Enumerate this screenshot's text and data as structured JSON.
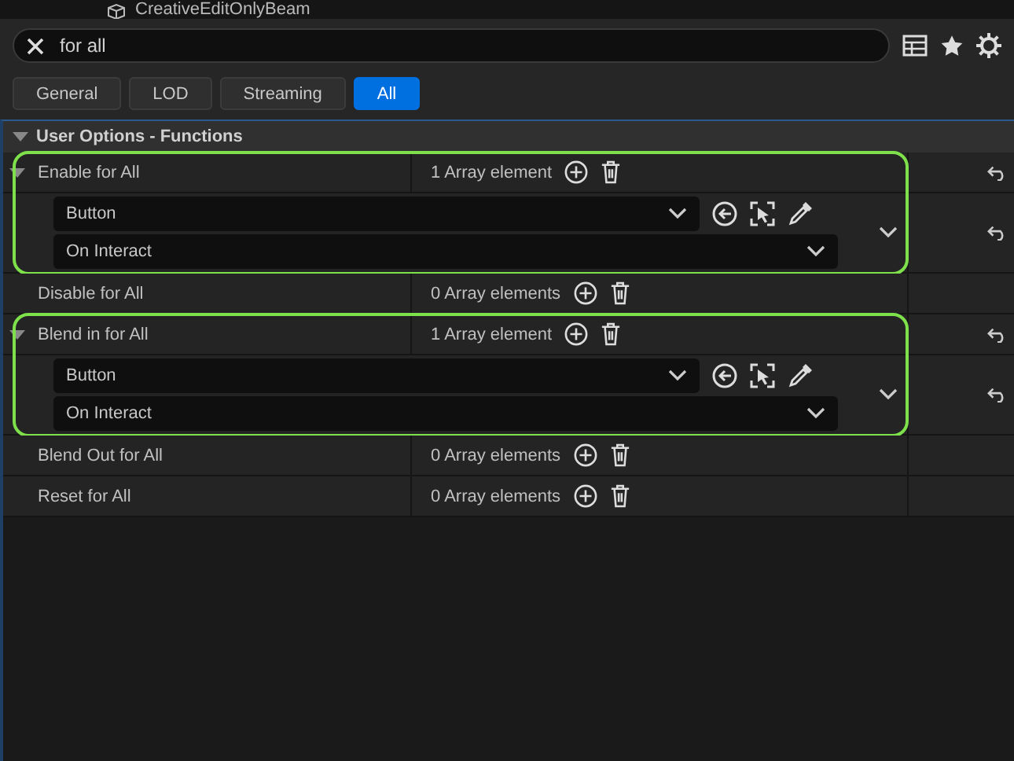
{
  "top_item": {
    "label": "CreativeEditOnlyBeam"
  },
  "search": {
    "value": "for all"
  },
  "tabs": [
    {
      "label": "General",
      "selected": false
    },
    {
      "label": "LOD",
      "selected": false
    },
    {
      "label": "Streaming",
      "selected": false
    },
    {
      "label": "All",
      "selected": true
    }
  ],
  "section": {
    "title": "User Options - Functions",
    "expanded": true
  },
  "properties": [
    {
      "name": "Enable for All",
      "count": "1 Array element",
      "expanded": true,
      "highlighted": true,
      "element": {
        "target": "Button",
        "event": "On Interact"
      }
    },
    {
      "name": "Disable for All",
      "count": "0 Array elements"
    },
    {
      "name": "Blend in for All",
      "count": "1 Array element",
      "expanded": true,
      "highlighted": true,
      "element": {
        "target": "Button",
        "event": "On Interact"
      }
    },
    {
      "name": "Blend Out for All",
      "count": "0 Array elements"
    },
    {
      "name": "Reset for All",
      "count": "0 Array elements"
    }
  ]
}
